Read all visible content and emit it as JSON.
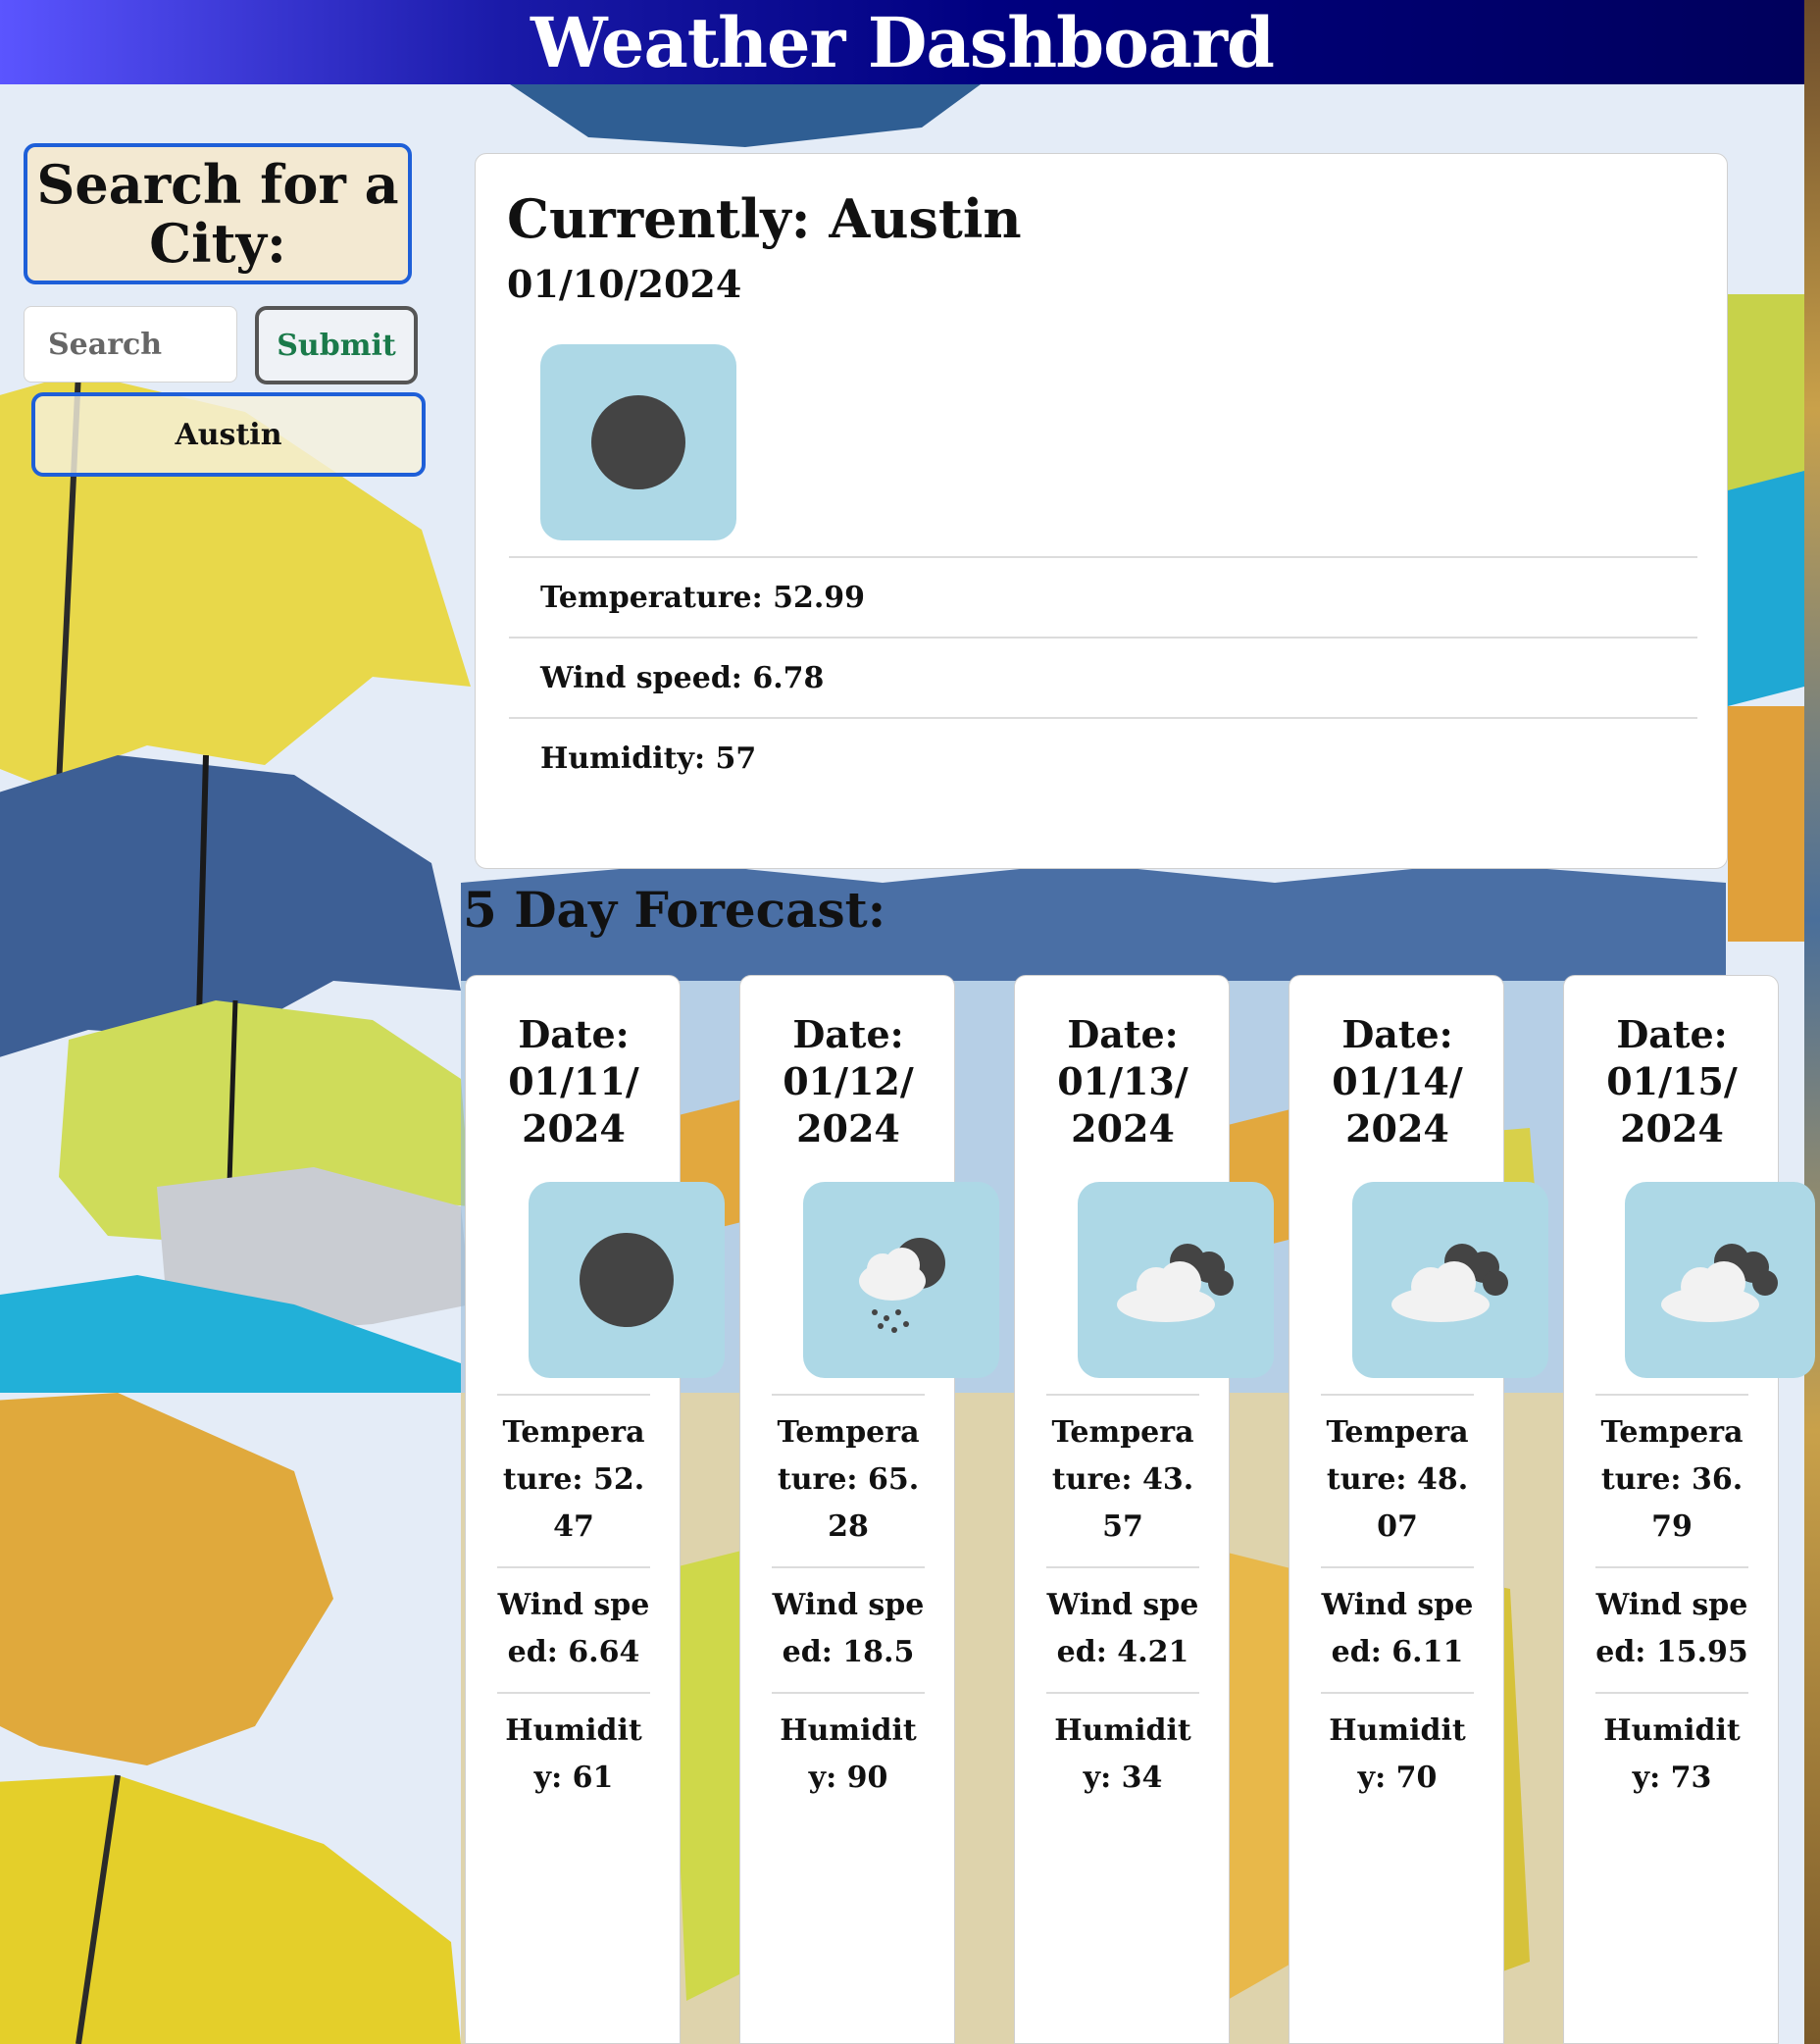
{
  "header": {
    "title": "Weather Dashboard"
  },
  "search": {
    "heading": "Search for a City:",
    "placeholder": "Search",
    "value": "",
    "submit_label": "Submit",
    "history": [
      "Austin"
    ]
  },
  "current": {
    "title": "Currently: Austin",
    "date": "01/10/2024",
    "icon": "clear-night-icon",
    "temperature": "Temperature: 52.99",
    "wind": "Wind speed: 6.78",
    "humidity": "Humidity: 57"
  },
  "forecast": {
    "heading": "5 Day Forecast:",
    "days": [
      {
        "date": "Date: 01/11/2024",
        "icon": "clear-night-icon",
        "temperature": "Temperature: 52.47",
        "wind": "Wind speed: 6.64",
        "humidity": "Humidity: 61"
      },
      {
        "date": "Date: 01/12/2024",
        "icon": "rain-night-icon",
        "temperature": "Temperature: 65.28",
        "wind": "Wind speed: 18.5",
        "humidity": "Humidity: 90"
      },
      {
        "date": "Date: 01/13/2024",
        "icon": "broken-clouds-icon",
        "temperature": "Temperature: 43.57",
        "wind": "Wind speed: 4.21",
        "humidity": "Humidity: 34"
      },
      {
        "date": "Date: 01/14/2024",
        "icon": "broken-clouds-icon",
        "temperature": "Temperature: 48.07",
        "wind": "Wind speed: 6.11",
        "humidity": "Humidity: 70"
      },
      {
        "date": "Date: 01/15/2024",
        "icon": "broken-clouds-icon",
        "temperature": "Temperature: 36.79",
        "wind": "Wind speed: 15.95",
        "humidity": "Humidity: 73"
      }
    ]
  },
  "colors": {
    "header_start": "#5b55ff",
    "header_end": "#00005c",
    "accent_border": "#1e5fd8",
    "submit_text": "#1a7a4a",
    "icon_bg": "#add8e6"
  }
}
